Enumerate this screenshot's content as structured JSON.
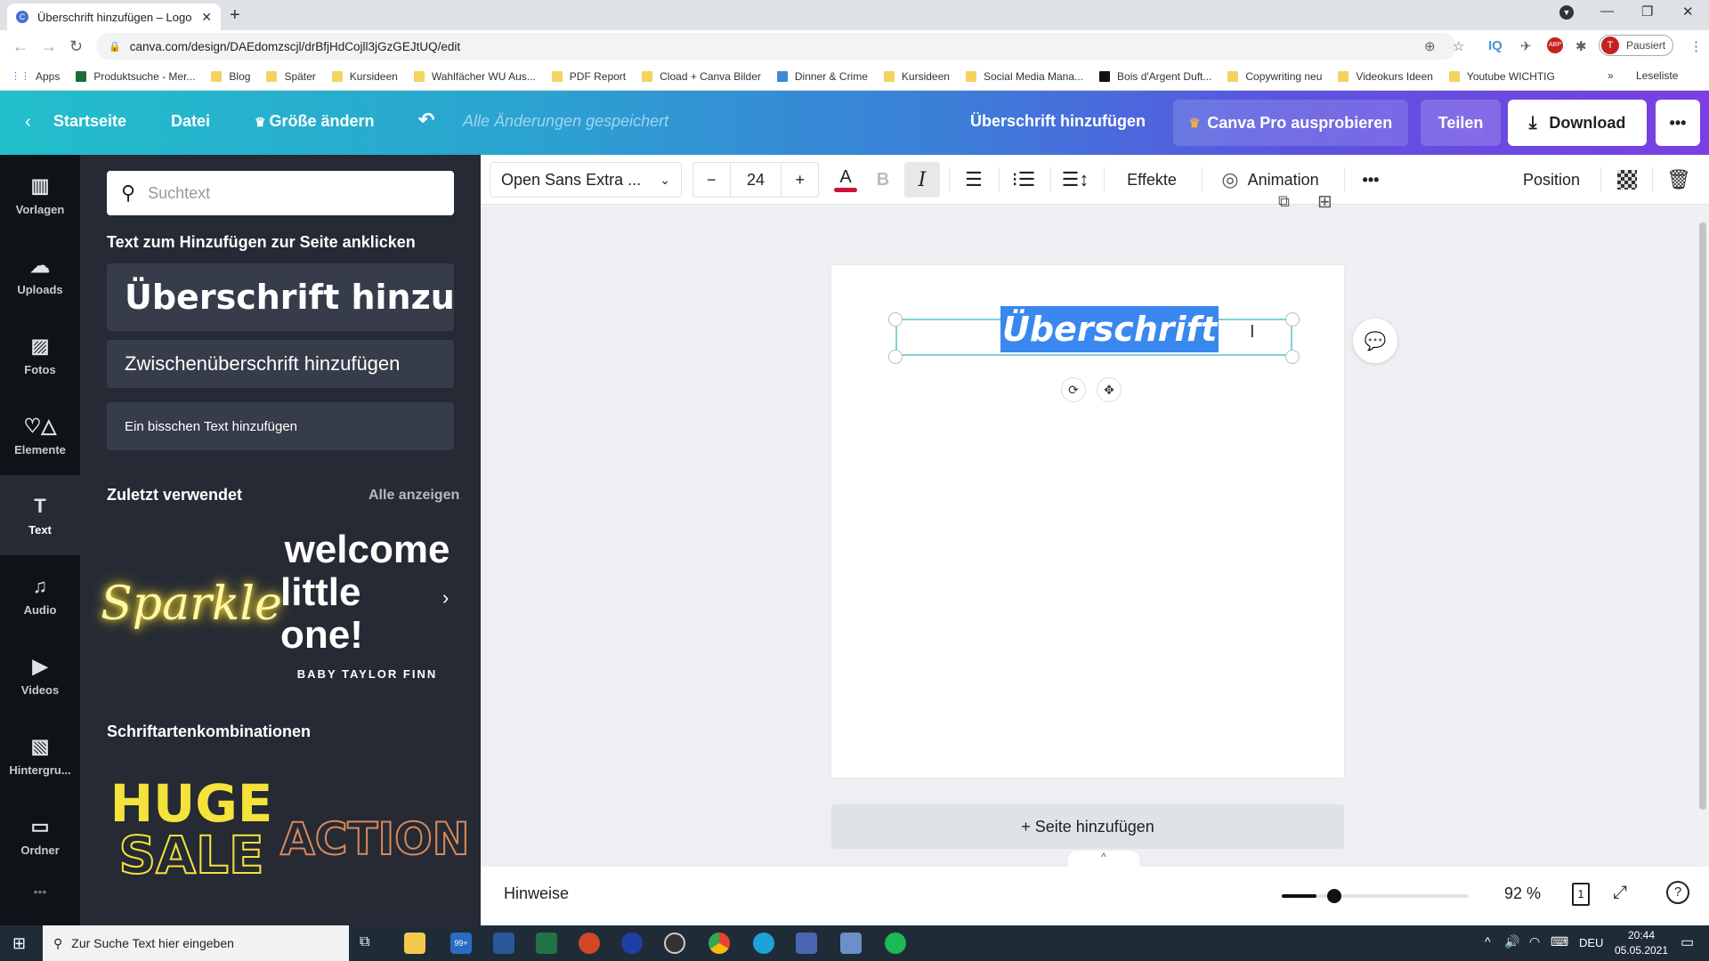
{
  "browser": {
    "tab_title": "Überschrift hinzufügen – Logo",
    "tab_favicon": "C",
    "url": "canva.com/design/DAEdomzscjl/drBfjHdCojll3jGzGEJtUQ/edit",
    "profile_initial": "T",
    "profile_status": "Pausiert",
    "bookmarks": [
      {
        "label": "Apps",
        "icon": "apps-grid"
      },
      {
        "label": "Produktsuche - Mer...",
        "icon": "site"
      },
      {
        "label": "Blog",
        "icon": "folder"
      },
      {
        "label": "Später",
        "icon": "folder"
      },
      {
        "label": "Kursideen",
        "icon": "folder"
      },
      {
        "label": "Wahlfächer WU Aus...",
        "icon": "folder"
      },
      {
        "label": "PDF Report",
        "icon": "folder"
      },
      {
        "label": "Cload + Canva Bilder",
        "icon": "folder"
      },
      {
        "label": "Dinner & Crime",
        "icon": "jd"
      },
      {
        "label": "Kursideen",
        "icon": "folder"
      },
      {
        "label": "Social Media Mana...",
        "icon": "folder"
      },
      {
        "label": "Bois d'Argent Duft...",
        "icon": "bois"
      },
      {
        "label": "Copywriting neu",
        "icon": "folder"
      },
      {
        "label": "Videokurs Ideen",
        "icon": "folder"
      },
      {
        "label": "Youtube WICHTIG",
        "icon": "folder"
      }
    ],
    "bookmarks_more": "»",
    "reading_list": "Leseliste"
  },
  "header": {
    "back_label": "Startseite",
    "file_label": "Datei",
    "resize_label": "Größe ändern",
    "save_status": "Alle Änderungen gespeichert",
    "design_title": "Überschrift hinzufügen",
    "pro_label": "Canva Pro ausprobieren",
    "share_label": "Teilen",
    "download_label": "Download",
    "more_label": "•••"
  },
  "rail": {
    "items": [
      {
        "label": "Vorlagen",
        "icon": "▥"
      },
      {
        "label": "Uploads",
        "icon": "☁"
      },
      {
        "label": "Fotos",
        "icon": "▨"
      },
      {
        "label": "Elemente",
        "icon": "♡△"
      },
      {
        "label": "Text",
        "icon": "T"
      },
      {
        "label": "Audio",
        "icon": "♫"
      },
      {
        "label": "Videos",
        "icon": "▶"
      },
      {
        "label": "Hintergru...",
        "icon": "▧"
      },
      {
        "label": "Ordner",
        "icon": "▭"
      }
    ],
    "active": "Text",
    "more": "•••"
  },
  "panel": {
    "search_placeholder": "Suchtext",
    "add_text_title": "Text zum Hinzufügen zur Seite anklicken",
    "heading_card": "Überschrift hinzu...",
    "subheading_card": "Zwischenüberschrift hinzufügen",
    "body_card": "Ein bisschen Text hinzufügen",
    "recent_title": "Zuletzt verwendet",
    "see_all": "Alle anzeigen",
    "recent_items": {
      "sparkle": "Sparkle",
      "welcome_line1": "welcome",
      "welcome_line2": "little one!",
      "welcome_sub": "BABY TAYLOR FINN"
    },
    "combos_title": "Schriftartenkombinationen",
    "combos": {
      "huge": "HUGE",
      "sale": "SALE",
      "action": "ACTION"
    }
  },
  "format_bar": {
    "font_name": "Open Sans Extra ...",
    "font_size": "24",
    "minus": "−",
    "plus": "+",
    "text_color": "#d0103a",
    "bold": "B",
    "italic": "I",
    "effects_label": "Effekte",
    "animation_label": "Animation",
    "more_label": "•••",
    "position_label": "Position"
  },
  "canvas": {
    "heading_text": "Überschrift",
    "add_page_label": "+ Seite hinzufügen"
  },
  "bottom_bar": {
    "notes_label": "Hinweise",
    "zoom_percent": 92,
    "zoom_label": "92 %",
    "page_count": "1"
  },
  "taskbar": {
    "search_placeholder": "Zur Suche Text hier eingeben",
    "mail_badge": "99+",
    "language": "DEU",
    "time": "20:44",
    "date": "05.05.2021"
  },
  "colors": {
    "header_gradient_start": "#22bfcb",
    "header_gradient_end": "#7b3fe4",
    "selection_blue": "#3a88ef",
    "selection_outline": "#7ed3d6",
    "panel_bg": "#252a34",
    "rail_bg": "#0e1318"
  }
}
